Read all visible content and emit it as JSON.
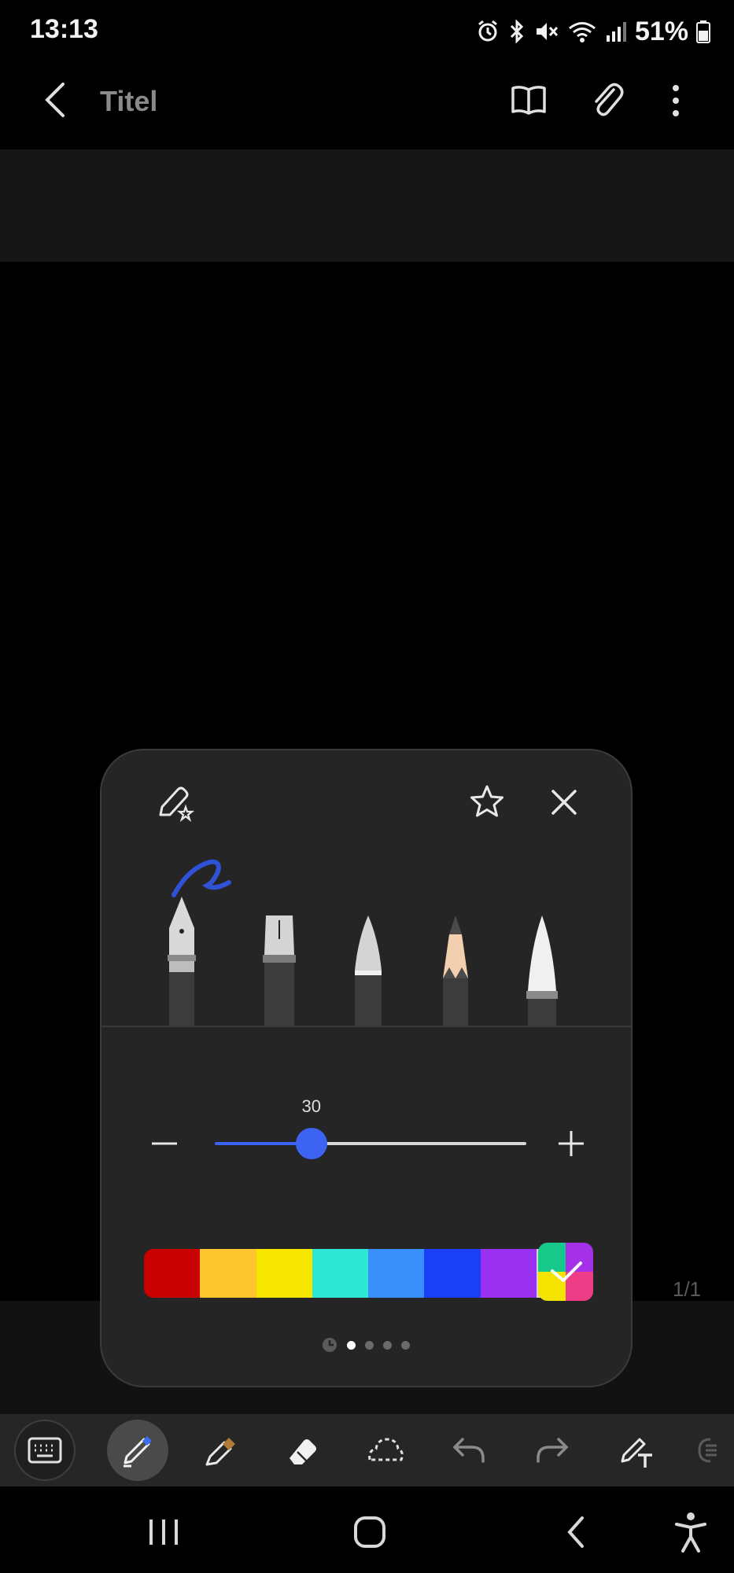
{
  "status_bar": {
    "time": "13:13",
    "battery": "51%",
    "icons": [
      "alarm-icon",
      "bluetooth-icon",
      "mute-icon",
      "wifi-icon",
      "signal-icon",
      "battery-icon"
    ]
  },
  "app_bar": {
    "title": "Titel",
    "icons": [
      "back-icon",
      "book-view-icon",
      "attach-icon",
      "more-options-icon"
    ]
  },
  "page": {
    "indicator": "1/1"
  },
  "pen_panel": {
    "pens": [
      "fountain-pen",
      "calligraphy-pen",
      "ballpoint-pen",
      "pencil",
      "brush"
    ],
    "selected_pen": "fountain-pen",
    "size": {
      "value": "30",
      "fraction": 0.31
    },
    "colors": [
      "#c80000",
      "#fec62e",
      "#f6e600",
      "#2ee6d4",
      "#3a90fa",
      "#1a3ff5",
      "#9a30f0",
      "#d6d6d6"
    ],
    "selected_swatch_colors": [
      "#18c98c",
      "#a431e8",
      "#f4e400",
      "#ec3d86"
    ],
    "page_dots": 4,
    "active_dot": 0
  },
  "toolbar": {
    "tools": [
      "keyboard-icon",
      "pen-icon",
      "highlighter-icon",
      "eraser-icon",
      "lasso-icon",
      "undo-icon",
      "redo-icon",
      "pen-to-text-icon"
    ],
    "active": "pen-icon"
  },
  "nav_bar": [
    "recent-apps-icon",
    "home-icon",
    "back-icon",
    "accessibility-icon"
  ]
}
